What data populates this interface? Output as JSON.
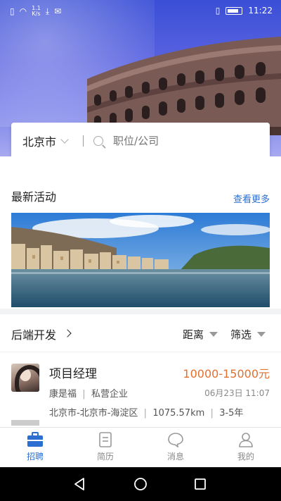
{
  "status_bar": {
    "speed_value": "1.1",
    "speed_unit": "K/s",
    "time": "11:22"
  },
  "search": {
    "city": "北京市",
    "placeholder": "职位/公司"
  },
  "activities": {
    "title": "最新活动",
    "more": "查看更多"
  },
  "jobs": {
    "category": "后端开发",
    "filters": [
      "距离",
      "筛选"
    ],
    "items": [
      {
        "title": "项目经理",
        "salary": "10000-15000元",
        "company": "康是福",
        "company_type": "私营企业",
        "date": "06月23日 11:07",
        "location": "北京市-北京市-海淀区",
        "distance": "1075.57km",
        "experience": "3-5年"
      }
    ]
  },
  "tabs": [
    {
      "label": "招聘",
      "icon": "briefcase-icon",
      "active": true
    },
    {
      "label": "简历",
      "icon": "document-icon",
      "active": false
    },
    {
      "label": "消息",
      "icon": "chat-bubble-icon",
      "active": false
    },
    {
      "label": "我的",
      "icon": "person-icon",
      "active": false
    }
  ],
  "colors": {
    "accent": "#2c6fd0",
    "salary": "#e2702f"
  }
}
